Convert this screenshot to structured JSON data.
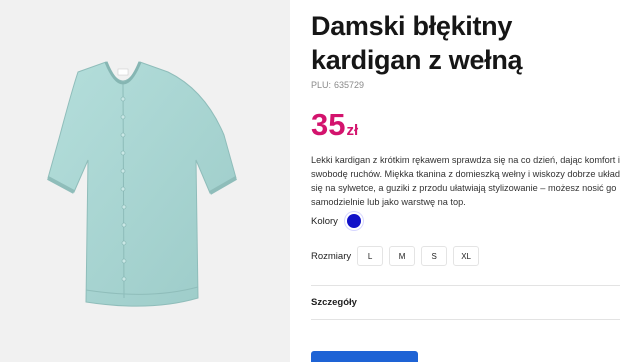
{
  "product": {
    "title_line1": "Damski błękitny",
    "title_line2": "kardigan z wełną",
    "plu_label": "PLU:",
    "plu_value": "635729",
    "price_amount": "35",
    "price_currency": "zł",
    "price_color": "#d3136d",
    "description_lines": [
      "Lekki kardigan z krótkim rękawem sprawdza się na co dzień, dając komfort i",
      "swobodę ruchów. Miękka tkanina z domieszką wełny i wiskozy dobrze układa",
      "się na sylwetce, a guziki z przodu ułatwiają stylizowanie – możesz nosić go",
      "samodzielnie lub jako warstwę na top."
    ]
  },
  "colors": {
    "label": "Kolory",
    "selected": "#1212c8"
  },
  "sizes": {
    "label": "Rozmiary",
    "options": [
      "L",
      "M",
      "S",
      "XL"
    ]
  },
  "details": {
    "label": "Szczegóły"
  },
  "image": {
    "icon": "cardigan-icon",
    "garment_color": "#a9d6d3"
  }
}
